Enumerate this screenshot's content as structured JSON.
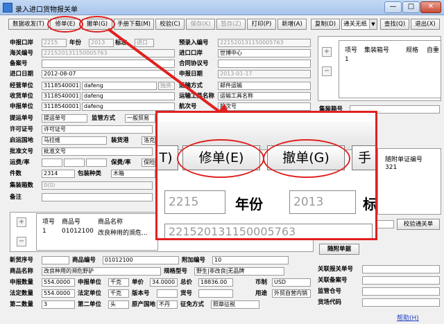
{
  "window": {
    "title": "录入进口货物报关单",
    "controls": {
      "minimize": "—",
      "maximize": "□",
      "close": "✕"
    }
  },
  "toolbar": {
    "btn_draft": "数据收发(T)",
    "btn_modify": "修单(E)",
    "btn_withdraw": "撤单(G)",
    "btn_manual": "手册下载(M)",
    "btn_verify": "校验(C)",
    "btn_save": "保存(K)",
    "btn_hold": "暂存(Z)",
    "btn_print": "打印(P)",
    "btn_new": "新增(A)",
    "btn_copy": "复制(D)",
    "select_value": "通关无纸",
    "btn_find": "查找(Q)",
    "btn_exit": "退出(X)"
  },
  "form": {
    "port_label": "申报口岸",
    "port_value": "2215",
    "year_label": "年份",
    "year_value": "2013",
    "mark_label": "标志",
    "mark_value": "进口",
    "prerecord_label": "预录入编号",
    "prerecord_value": "221520131150005763",
    "customs_no_label": "海关编号",
    "customs_no_value": "221520131150005763",
    "import_port_label": "进口口岸",
    "import_port_value": "世博中心",
    "record_no_label": "备案号",
    "record_no_value": "",
    "contract_label": "合同协议号",
    "contract_value": "",
    "import_date_label": "进口日期",
    "import_date_value": "2012-08-07",
    "declare_date_label": "申报日期",
    "declare_date_value": "2013-01-17",
    "operator_label": "经营单位",
    "operator_code": "3118540001",
    "operator_name": "dafeng",
    "operator_tag": "独资",
    "transport_label": "运输方式",
    "transport_value": "邮件运输",
    "consignee_label": "收货单位",
    "consignee_code": "3118540001",
    "consignee_name": "dafeng",
    "vehicle_label": "运输工具名称",
    "vehicle_value": "运输工具名称",
    "declarant_label": "申报单位",
    "declarant_code": "3118540001",
    "declarant_name": "dafeng",
    "voyage_label": "航次号",
    "voyage_value": "航次号",
    "bill_label": "提运单号",
    "bill_value": "提运单号",
    "supervise_label": "监管方式",
    "supervise_value": "一般贸易",
    "license_label": "许可证号",
    "license_value": "许可证号",
    "origin_label": "启运国地",
    "origin_value": "马拉维",
    "loading_label": "装货港",
    "loading_value": "洛克",
    "approval_label": "批准文号",
    "approval_value": "批准文号",
    "freight_label": "运费/率",
    "insurance_label": "保费/率",
    "insurance_value": "保险",
    "pieces_label": "件数",
    "pieces_value": "2314",
    "package_label": "包装种类",
    "package_value": "木箱",
    "container_count_label": "集装箱数",
    "container_count_value": "0(0)",
    "remark_label": "备注",
    "remark_value": ""
  },
  "right": {
    "grid_headers": [
      "项号",
      "集装箱号",
      "规格",
      "自重"
    ],
    "grid_row": [
      "1",
      "",
      "",
      ""
    ],
    "plus": "+",
    "minus": "−",
    "container_no_label": "集装箱号",
    "attach_header": "随附单证编号",
    "attach_value": "321",
    "verify_btn": "校验通关单",
    "attach_btn": "随附单据",
    "customs_declare_label": "关联报关单号",
    "record_assoc_label": "关联备案号",
    "warehouse_label": "监管仓号",
    "yard_label": "货场代码",
    "help_link": "帮助(H)"
  },
  "goods": {
    "headers": [
      "项号",
      "商品号",
      "商品名称"
    ],
    "row": [
      "1",
      "01012100",
      "改良种用的濒危..."
    ],
    "plus": "+",
    "minus": "−",
    "new_trade_label": "新贸序号",
    "goods_no_label": "商品编号",
    "goods_no_value": "01012100",
    "extra_no_label": "附加编号",
    "extra_no_value": "10",
    "name_label": "商品名称",
    "name_value": "改良种用的濒危野驴",
    "spec_label": "规格型号",
    "spec_value": "野生|非改良|无品牌",
    "qty_label": "申报数量",
    "qty_value": "554.0000",
    "unit_label": "申报单位",
    "unit_value": "千克",
    "price_label": "单价",
    "price_value": "34.0000",
    "total_label": "总价",
    "total_value": "18836.00",
    "currency_label": "币制",
    "currency_value": "USD",
    "legal_qty_label": "法定数量",
    "legal_qty_value": "554.0000",
    "legal_unit_label": "法定单位",
    "legal_unit_value": "千克",
    "version_label": "版本号",
    "item_no_label": "货号",
    "use_label": "用途",
    "use_value": "外贸自营内销",
    "second_qty_label": "第二数量",
    "second_qty_value": "3",
    "second_unit_label": "第二单位",
    "second_unit_value": "头",
    "country_label": "原产国地",
    "country_value": "不丹",
    "tax_label": "征免方式",
    "tax_value": "照章征税"
  },
  "zoom": {
    "partial_left": "T)",
    "modify": "修单(E)",
    "withdraw": "撤单(G)",
    "partial_right": "手",
    "port": "2215",
    "year_label": "年份",
    "year": "2013",
    "mark_partial": "标",
    "number": "221520131150005763"
  },
  "colors": {
    "highlight": "#e02020",
    "arrow": "#e02020"
  }
}
